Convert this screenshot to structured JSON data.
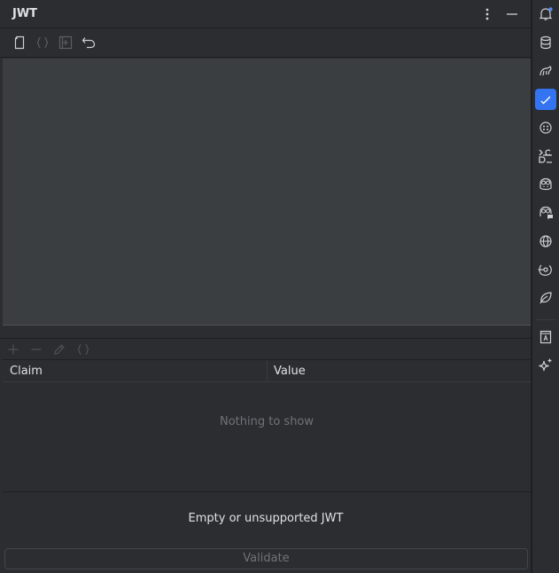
{
  "window": {
    "title": "JWT"
  },
  "header": {
    "options_icon": "more-vertical-icon",
    "minimize_icon": "minimize-icon"
  },
  "toolbar": {
    "icons": [
      "new-file-icon",
      "braces-icon",
      "add-frame-icon",
      "undo-icon"
    ]
  },
  "claims_toolbar": {
    "icons": [
      "add-icon",
      "remove-icon",
      "edit-icon",
      "braces-icon"
    ]
  },
  "table": {
    "columns": [
      "Claim",
      "Value"
    ],
    "rows": [],
    "empty_text": "Nothing to show"
  },
  "status": {
    "message": "Empty or unsupported JWT"
  },
  "validate": {
    "label": "Validate"
  },
  "colors": {
    "accent": "#3574f0",
    "background": "#2b2d30",
    "editor": "#3b3e41",
    "muted_text": "#6f737a"
  },
  "rail": {
    "icons": [
      "notifications-icon",
      "database-icon",
      "gradle-icon",
      "jwt-icon",
      "ai-assistant-icon",
      "docker-compose-icon",
      "copilot-icon",
      "copilot-chat-icon",
      "web-icon",
      "endpoints-icon",
      "leaf-icon",
      "translate-icon",
      "sparkle-icon"
    ],
    "active": "jwt-icon"
  }
}
